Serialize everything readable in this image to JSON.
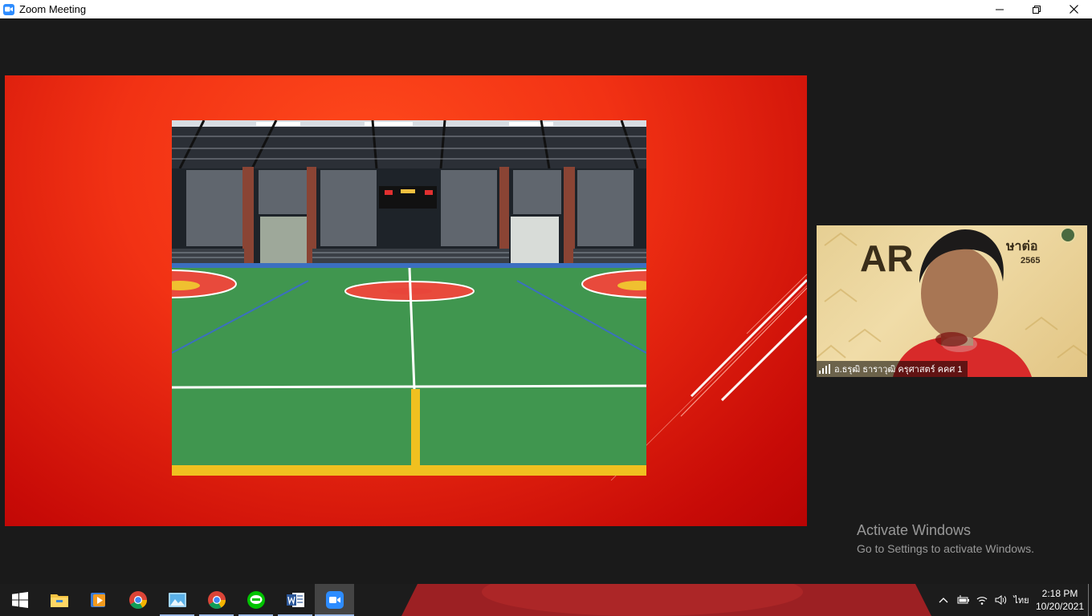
{
  "window": {
    "title": "Zoom Meeting",
    "controls": {
      "minimize": "—",
      "maximize": "❐",
      "close": "✕"
    }
  },
  "video": {
    "participant_name": "อ.ธรุฒิ ธาราวุฒิ ครุศาสตร์ คคศ 1",
    "background_text": {
      "logo": "AR",
      "thai_right": "ษาต่อ",
      "year": "2565"
    }
  },
  "watermark": {
    "title": "Activate Windows",
    "subtitle": "Go to Settings to activate Windows."
  },
  "taskbar": {
    "apps": [
      {
        "icon": "windows-start-icon",
        "running": false
      },
      {
        "icon": "file-explorer-icon",
        "running": false
      },
      {
        "icon": "media-player-icon",
        "running": false
      },
      {
        "icon": "chrome-icon",
        "running": false
      },
      {
        "icon": "photos-icon",
        "running": true
      },
      {
        "icon": "chrome-icon",
        "running": true
      },
      {
        "icon": "line-icon",
        "running": true
      },
      {
        "icon": "word-icon",
        "running": true
      },
      {
        "icon": "zoom-icon",
        "running": true,
        "active": true
      }
    ],
    "tray": {
      "language": "ไทย",
      "time": "2:18 PM",
      "date": "10/20/2021"
    }
  }
}
